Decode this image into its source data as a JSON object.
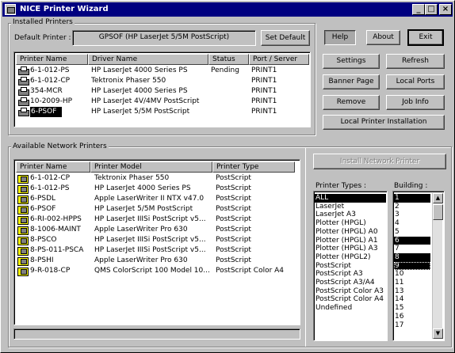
{
  "window": {
    "title": "NICE Printer Wizard"
  },
  "titlebar_buttons": [
    "_",
    "□",
    "×"
  ],
  "installed": {
    "group_label": "Installed Printers",
    "default_label": "Default Printer :",
    "default_value": "GPSOF (HP LaserJet 5/5M PostScript)",
    "set_default": "Set Default",
    "columns": [
      "Printer Name",
      "Driver Name",
      "Status",
      "Port / Server"
    ],
    "rows": [
      {
        "name": "6-1-012-PS",
        "driver": "HP LaserJet 4000 Series PS",
        "status": "Pending",
        "port": "PRINT1"
      },
      {
        "name": "6-1-012-CP",
        "driver": "Tektronix Phaser 550",
        "status": "",
        "port": "PRINT1"
      },
      {
        "name": "354-MCR",
        "driver": "HP LaserJet 4000 Series PS",
        "status": "",
        "port": "PRINT1"
      },
      {
        "name": "10-2009-HP",
        "driver": "HP LaserJet 4V/4MV PostScript",
        "status": "",
        "port": "PRINT1"
      },
      {
        "name": "6-PSOF",
        "driver": "HP LaserJet 5/5M PostScript",
        "status": "",
        "port": "PRINT1"
      }
    ]
  },
  "buttons": {
    "help": "Help",
    "about": "About",
    "exit": "Exit",
    "settings": "Settings",
    "refresh": "Refresh",
    "banner_page": "Banner Page",
    "local_ports": "Local Ports",
    "remove": "Remove",
    "job_info": "Job Info",
    "local_install": "Local Printer Installation",
    "install_network": "Install Network Printer"
  },
  "network": {
    "group_label": "Available Network Printers",
    "columns": [
      "Printer Name",
      "Printer Model",
      "Printer Type"
    ],
    "rows": [
      {
        "name": "6-1-012-CP",
        "model": "Tektronix Phaser 550",
        "type": "PostScript"
      },
      {
        "name": "6-1-012-PS",
        "model": "HP LaserJet 4000 Series PS",
        "type": "PostScript"
      },
      {
        "name": "6-PSDL",
        "model": "Apple LaserWriter II NTX v47.0",
        "type": "PostScript"
      },
      {
        "name": "6-PSOF",
        "model": "HP LaserJet 5/5M PostScript",
        "type": "PostScript"
      },
      {
        "name": "6-RI-002-HPPS",
        "model": "HP LaserJet IIISi PostScript v5...",
        "type": "PostScript"
      },
      {
        "name": "8-1006-MAINT",
        "model": "Apple LaserWriter Pro 630",
        "type": "PostScript"
      },
      {
        "name": "8-PSCO",
        "model": "HP LaserJet IIISi PostScript v5...",
        "type": "PostScript"
      },
      {
        "name": "8-PS-011-PSCA",
        "model": "HP LaserJet IIISi PostScript v5...",
        "type": "PostScript"
      },
      {
        "name": "8-PSHI",
        "model": "Apple LaserWriter Pro 630",
        "type": "PostScript"
      },
      {
        "name": "9-R-018-CP",
        "model": "QMS ColorScript 100 Model 10...",
        "type": "PostScript Color A4"
      }
    ]
  },
  "printer_types": {
    "label": "Printer Types :",
    "items": [
      "ALL",
      "LaserJet",
      "LaserJet A3",
      "Plotter (HPGL)",
      "Plotter (HPGL) A0",
      "Plotter (HPGL) A1",
      "Plotter (HPGL) A3",
      "Plotter (HPGL2)",
      "PostScript",
      "PostScript A3",
      "PostScript A3/A4",
      "PostScript Color A3",
      "PostScript Color A4",
      "Undefined"
    ],
    "selected": [
      0
    ]
  },
  "building": {
    "label": "Building :",
    "items": [
      "1",
      "2",
      "3",
      "4",
      "5",
      "6",
      "7",
      "8",
      "9",
      "10",
      "11",
      "13",
      "14",
      "15",
      "16",
      "17"
    ],
    "selected": [
      0,
      5,
      7,
      8
    ]
  }
}
